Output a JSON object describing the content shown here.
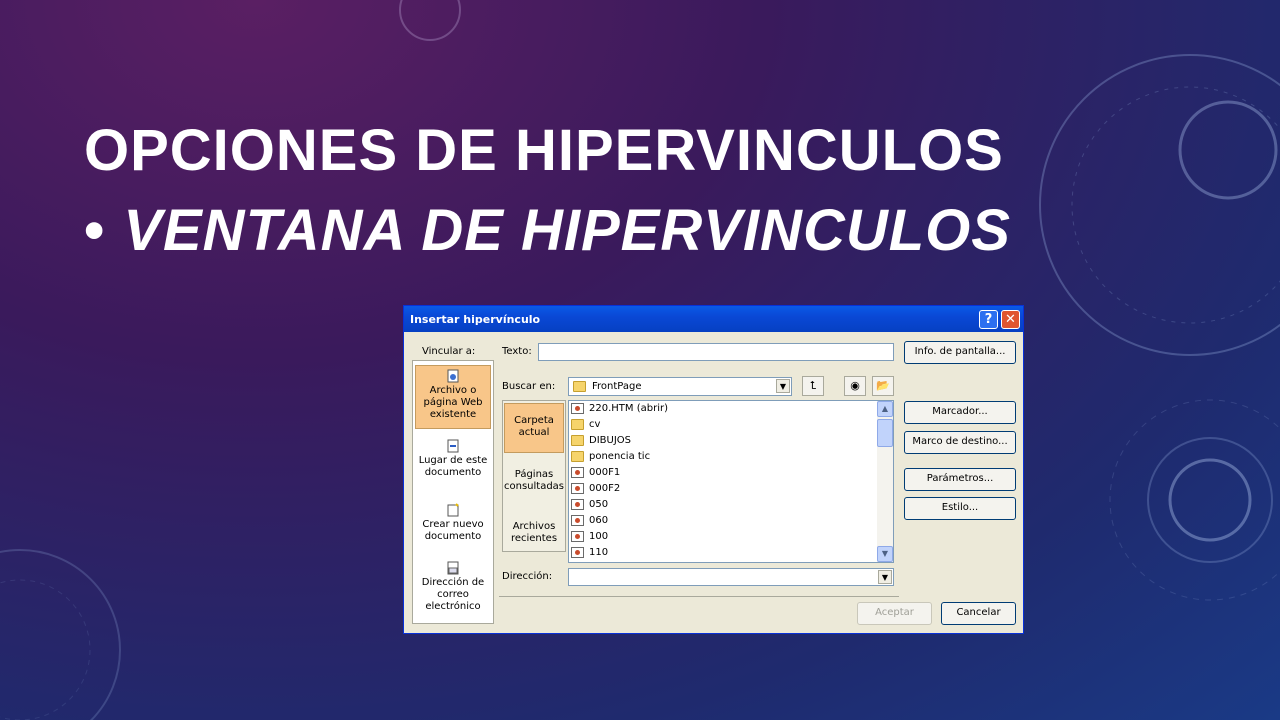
{
  "slide": {
    "title": "OPCIONES DE HIPERVINCULOS",
    "bullet": "•",
    "subtitle": "VENTANA DE HIPERVINCULOS"
  },
  "dialog": {
    "title": "Insertar hipervínculo",
    "help_label": "?",
    "close_label": "✕",
    "link_to_label": "Vincular a:",
    "text_label": "Texto:",
    "text_value": "",
    "screen_tip_button": "Info. de pantalla...",
    "look_in_label": "Buscar en:",
    "look_in_value": "FrontPage",
    "link_options": [
      {
        "label": "Archivo o página Web existente",
        "icon": "web-page-icon",
        "selected": true
      },
      {
        "label": "Lugar de este documento",
        "icon": "document-place-icon",
        "selected": false
      },
      {
        "label": "Crear nuevo documento",
        "icon": "new-document-icon",
        "selected": false
      },
      {
        "label": "Dirección de correo electrónico",
        "icon": "email-icon",
        "selected": false
      }
    ],
    "sidebar": [
      {
        "label": "Carpeta actual",
        "selected": true
      },
      {
        "label": "Páginas consultadas",
        "selected": false
      },
      {
        "label": "Archivos recientes",
        "selected": false
      }
    ],
    "files": [
      {
        "name": "220.HTM (abrir)",
        "type": "page"
      },
      {
        "name": "cv",
        "type": "folder"
      },
      {
        "name": "DIBUJOS",
        "type": "folder"
      },
      {
        "name": "ponencia tic",
        "type": "folder"
      },
      {
        "name": "000F1",
        "type": "page"
      },
      {
        "name": "000F2",
        "type": "page"
      },
      {
        "name": "050",
        "type": "page"
      },
      {
        "name": "060",
        "type": "page"
      },
      {
        "name": "100",
        "type": "page"
      },
      {
        "name": "110",
        "type": "page"
      }
    ],
    "right_buttons": {
      "bookmark": "Marcador...",
      "target_frame": "Marco de destino...",
      "parameters": "Parámetros...",
      "style": "Estilo..."
    },
    "address_label": "Dirección:",
    "address_value": "",
    "ok_button": "Aceptar",
    "cancel_button": "Cancelar"
  },
  "colors": {
    "title_text": "#ffffff",
    "dialog_face": "#ece9d8",
    "titlebar": "#0a48d6",
    "selected_item": "#f8c689"
  }
}
